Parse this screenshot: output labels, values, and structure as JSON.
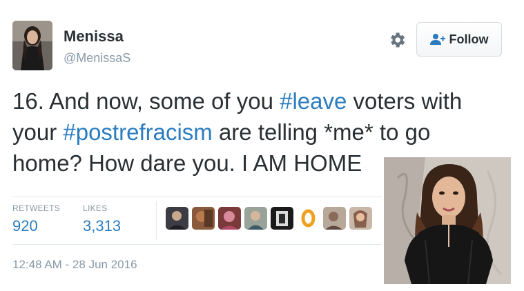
{
  "user": {
    "display_name": "Menissa",
    "handle": "@MenissaS",
    "avatar_icon": "profile-photo"
  },
  "actions": {
    "settings_icon": "gear-icon",
    "follow_label": "Follow"
  },
  "tweet": {
    "line1_pre": "16. And now, some of you ",
    "hashtag1": "#leave",
    "line1_post": " voters with",
    "line2_pre": "your ",
    "hashtag2": "#postrefracism",
    "line2_post": " are telling *me* to go",
    "line3": "home? How dare you. I AM HOME"
  },
  "stats": {
    "retweets_label": "RETWEETS",
    "retweets_value": "920",
    "likes_label": "LIKES",
    "likes_value": "3,313"
  },
  "likers": [
    "avatar-1",
    "avatar-2",
    "avatar-3",
    "avatar-4",
    "avatar-5",
    "avatar-6",
    "avatar-7",
    "avatar-8"
  ],
  "timestamp": "12:48 AM - 28 Jun 2016",
  "colors": {
    "link": "#2a7cbf",
    "text": "#292f33",
    "muted": "#8899a6",
    "divider": "#e1e8ed"
  }
}
